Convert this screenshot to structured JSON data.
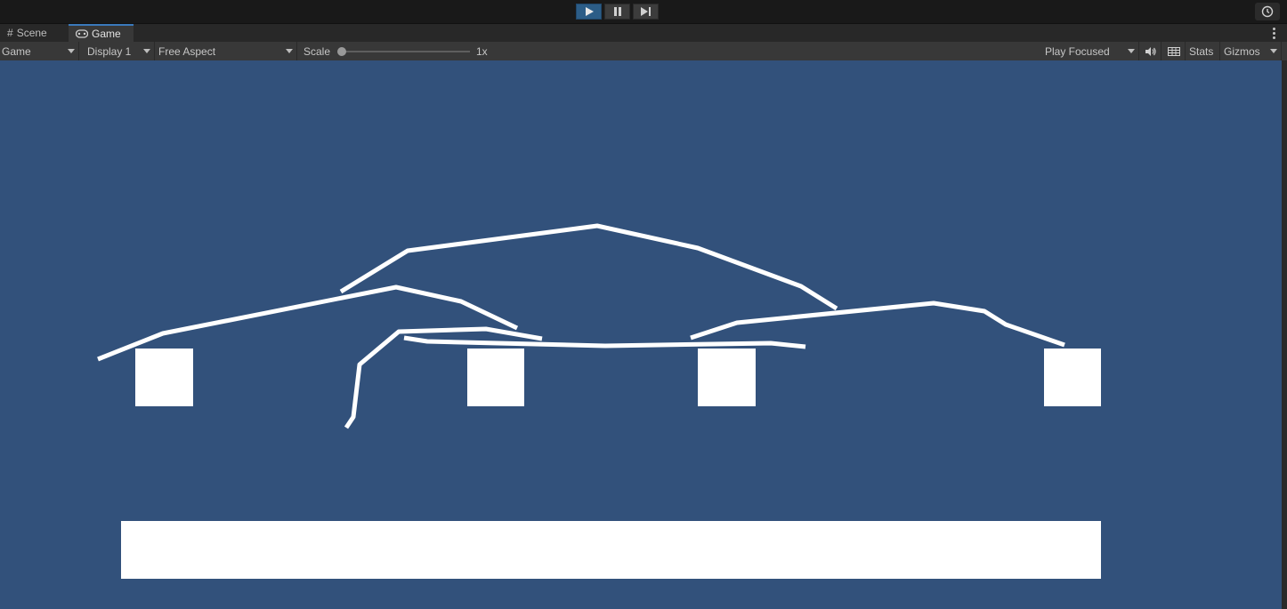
{
  "play_controls": {
    "play": {
      "icon": "play-icon",
      "active": true
    },
    "pause": {
      "icon": "pause-icon"
    },
    "step": {
      "icon": "step-icon"
    }
  },
  "history_icon": "history-icon",
  "tabs": [
    {
      "label": "Scene",
      "icon": "grid-icon",
      "active": false
    },
    {
      "label": "Game",
      "icon": "gamepad-icon",
      "active": true
    }
  ],
  "toolbar": {
    "view_select": "Game",
    "display_select": "Display 1",
    "aspect_select": "Free Aspect",
    "scale_label": "Scale",
    "scale_value": "1x",
    "scale_slider_position": 0.0,
    "play_mode_select": "Play Focused",
    "audio_icon": "speaker-icon",
    "stats_label": "Stats",
    "gizmos_label": "Gizmos"
  },
  "colors": {
    "game_background": "#32517b",
    "objects": "#ffffff",
    "active_play": "#2c5d87",
    "active_tab_accent": "#3a79bb"
  },
  "game_scene": {
    "objects": [
      "white-square",
      "white-square",
      "white-square",
      "white-square",
      "white-ground-platform"
    ],
    "drawn_lines": 7
  }
}
